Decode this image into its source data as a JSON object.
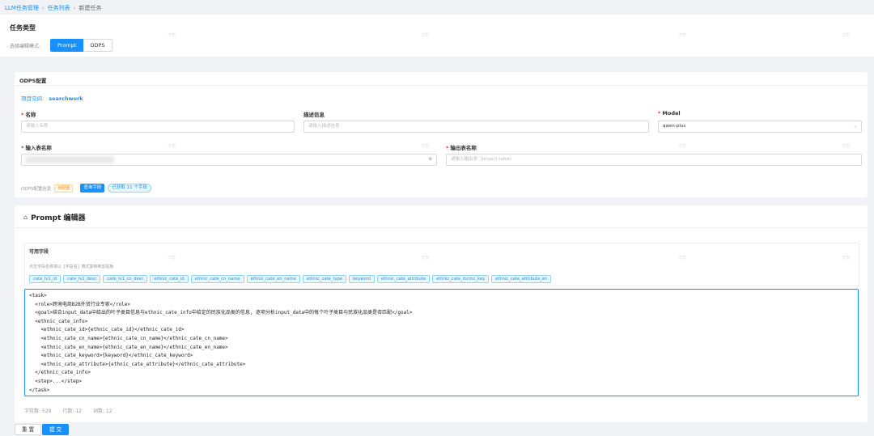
{
  "breadcrumb": {
    "item1": "LLM任务管理",
    "item2": "任务列表",
    "item3": "新建任务"
  },
  "task_type": {
    "title": "任务类型",
    "mode_label": "选择编辑模式:",
    "modes": [
      "Prompt",
      "ODPS"
    ]
  },
  "odps": {
    "title": "ODPS配置",
    "project_label": "项目空间:",
    "project_value": "searchwork",
    "name_label": "名称",
    "name_placeholder": "请输入名称",
    "desc_label": "描述信息",
    "desc_placeholder": "请输入描述信息",
    "model_label": "Model",
    "model_value": "qwen-plus",
    "input_table_label": "输入表名称",
    "output_table_label": "输出表名称",
    "output_table_placeholder": "请输入输出表（project.table）",
    "status_label": "ODPS配置信息",
    "status_badge": "待配置",
    "query_button": "查询字段",
    "fetched_badge": "已获取 11 个字段"
  },
  "prompt_editor": {
    "title": "Prompt 编辑器",
    "fields_title": "可用字段",
    "fields_hint": "点击字段名称将以 {字段名} 格式复制到剪贴板",
    "fields": [
      "cate_lv1_id",
      "cate_lv1_desc",
      "cate_lv1_cn_desc",
      "ethnic_cate_id",
      "ethnic_cate_cn_name",
      "ethnic_cate_en_name",
      "ethnic_cate_type",
      "keyword",
      "ethnic_cate_attribute",
      "ethnic_cate_mcmc_key",
      "ethnic_cate_attribute_en"
    ],
    "content": "<task>\n  <role>跨境电商B2B外贸行业专家</role>\n  <goal>结合input_data中给出的叶子类目信息与ethnic_cate_info中给定的民族化品类的信息, 逐项分析input_data中的每个叶子类目与民族化品类是否匹配</goal>\n  <ethnic_cate_info>\n    <ethnic_cate_id>{ethnic_cate_id}</ethnic_cate_id>\n    <ethnic_cate_cn_name>{ethnic_cate_cn_name}</ethnic_cate_cn_name>\n    <ethnic_cate_en_name>{ethnic_cate_en_name}</ethnic_cate_en_name>\n    <ethnic_cate_keyword>{keyword}</ethnic_cate_keyword>\n    <ethnic_cate_attribute>{ethnic_cate_attribute}</ethnic_cate_attribute>\n  </ethnic_cate_info>\n  <step>...</step>\n</task>",
    "char_count": "字符数: 529",
    "line_count": "行数: 12",
    "word_count": "词数: 12"
  },
  "actions": {
    "reset": "重 置",
    "submit": "提 交"
  },
  "watermark": "洋葱"
}
